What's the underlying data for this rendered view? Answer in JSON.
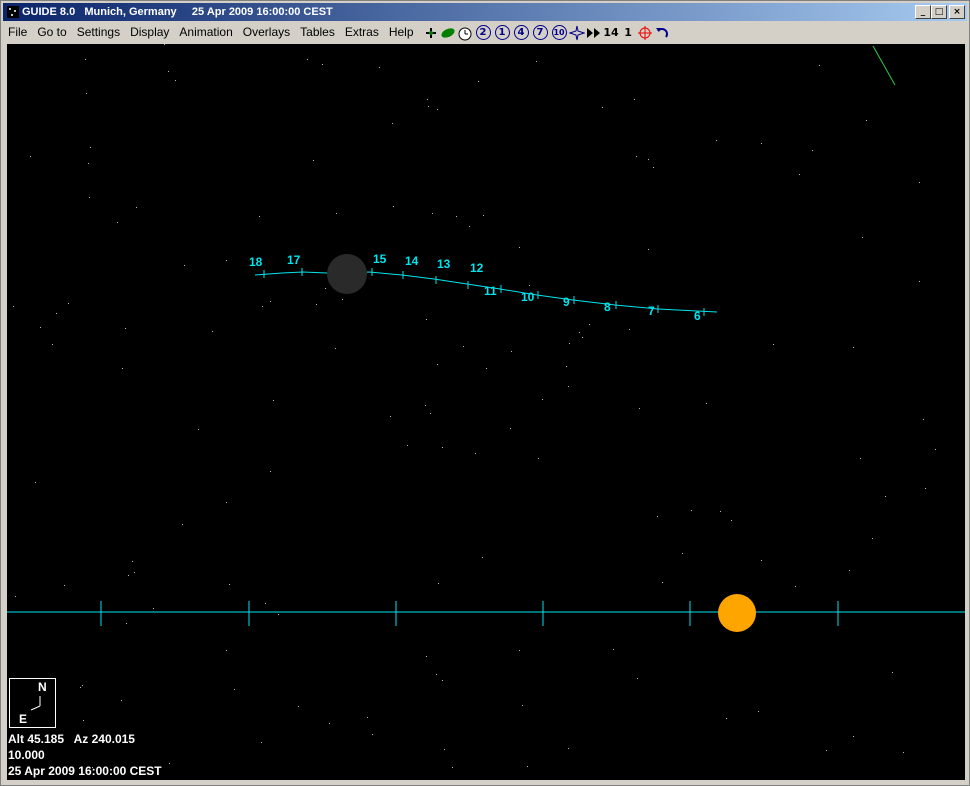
{
  "window": {
    "title": "GUIDE 8.0   Munich, Germany     25 Apr 2009 16:00:00 CEST",
    "minimize_glyph": "_",
    "maximize_glyph": "□",
    "close_glyph": "×"
  },
  "menu": {
    "file": "File",
    "goto": "Go to",
    "settings": "Settings",
    "display": "Display",
    "animation": "Animation",
    "overlays": "Overlays",
    "tables": "Tables",
    "extras": "Extras",
    "help": "Help"
  },
  "toolbar": {
    "icons": [
      "planet-icon",
      "comet-icon",
      "clock-icon",
      "zoom-2-icon",
      "zoom-1-icon",
      "zoom-4-icon",
      "zoom-7-icon",
      "zoom-10-icon",
      "star-burst-icon",
      "fast-forward-icon",
      "step-14-icon",
      "step-1-icon",
      "target-icon",
      "undo-icon"
    ],
    "zoom_2": "2",
    "zoom_1": "1",
    "zoom_4": "4",
    "zoom_7": "7",
    "zoom_10": "10",
    "step_14": "14",
    "step_1": "1"
  },
  "sky": {
    "background": "#000000",
    "track_color": "#00e5ee",
    "moon_color": "#2a2a2a",
    "sun_color": "#ffa500",
    "track_labels": [
      "18",
      "17",
      "15",
      "14",
      "13",
      "12",
      "11",
      "10",
      "9",
      "8",
      "7",
      "6"
    ]
  },
  "compass": {
    "north": "N",
    "east": "E"
  },
  "status": {
    "alt_az": "Alt 45.185   Az 240.015",
    "field": "10.000",
    "datetime": "25 Apr 2009 16:00:00 CEST"
  }
}
